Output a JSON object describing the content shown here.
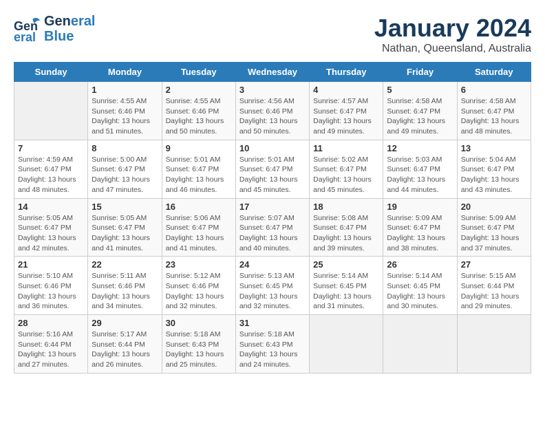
{
  "header": {
    "logo_line1": "General",
    "logo_line2": "Blue",
    "month": "January 2024",
    "location": "Nathan, Queensland, Australia"
  },
  "weekdays": [
    "Sunday",
    "Monday",
    "Tuesday",
    "Wednesday",
    "Thursday",
    "Friday",
    "Saturday"
  ],
  "weeks": [
    [
      {
        "day": "",
        "info": ""
      },
      {
        "day": "1",
        "info": "Sunrise: 4:55 AM\nSunset: 6:46 PM\nDaylight: 13 hours\nand 51 minutes."
      },
      {
        "day": "2",
        "info": "Sunrise: 4:55 AM\nSunset: 6:46 PM\nDaylight: 13 hours\nand 50 minutes."
      },
      {
        "day": "3",
        "info": "Sunrise: 4:56 AM\nSunset: 6:46 PM\nDaylight: 13 hours\nand 50 minutes."
      },
      {
        "day": "4",
        "info": "Sunrise: 4:57 AM\nSunset: 6:47 PM\nDaylight: 13 hours\nand 49 minutes."
      },
      {
        "day": "5",
        "info": "Sunrise: 4:58 AM\nSunset: 6:47 PM\nDaylight: 13 hours\nand 49 minutes."
      },
      {
        "day": "6",
        "info": "Sunrise: 4:58 AM\nSunset: 6:47 PM\nDaylight: 13 hours\nand 48 minutes."
      }
    ],
    [
      {
        "day": "7",
        "info": "Sunrise: 4:59 AM\nSunset: 6:47 PM\nDaylight: 13 hours\nand 48 minutes."
      },
      {
        "day": "8",
        "info": "Sunrise: 5:00 AM\nSunset: 6:47 PM\nDaylight: 13 hours\nand 47 minutes."
      },
      {
        "day": "9",
        "info": "Sunrise: 5:01 AM\nSunset: 6:47 PM\nDaylight: 13 hours\nand 46 minutes."
      },
      {
        "day": "10",
        "info": "Sunrise: 5:01 AM\nSunset: 6:47 PM\nDaylight: 13 hours\nand 45 minutes."
      },
      {
        "day": "11",
        "info": "Sunrise: 5:02 AM\nSunset: 6:47 PM\nDaylight: 13 hours\nand 45 minutes."
      },
      {
        "day": "12",
        "info": "Sunrise: 5:03 AM\nSunset: 6:47 PM\nDaylight: 13 hours\nand 44 minutes."
      },
      {
        "day": "13",
        "info": "Sunrise: 5:04 AM\nSunset: 6:47 PM\nDaylight: 13 hours\nand 43 minutes."
      }
    ],
    [
      {
        "day": "14",
        "info": "Sunrise: 5:05 AM\nSunset: 6:47 PM\nDaylight: 13 hours\nand 42 minutes."
      },
      {
        "day": "15",
        "info": "Sunrise: 5:05 AM\nSunset: 6:47 PM\nDaylight: 13 hours\nand 41 minutes."
      },
      {
        "day": "16",
        "info": "Sunrise: 5:06 AM\nSunset: 6:47 PM\nDaylight: 13 hours\nand 41 minutes."
      },
      {
        "day": "17",
        "info": "Sunrise: 5:07 AM\nSunset: 6:47 PM\nDaylight: 13 hours\nand 40 minutes."
      },
      {
        "day": "18",
        "info": "Sunrise: 5:08 AM\nSunset: 6:47 PM\nDaylight: 13 hours\nand 39 minutes."
      },
      {
        "day": "19",
        "info": "Sunrise: 5:09 AM\nSunset: 6:47 PM\nDaylight: 13 hours\nand 38 minutes."
      },
      {
        "day": "20",
        "info": "Sunrise: 5:09 AM\nSunset: 6:47 PM\nDaylight: 13 hours\nand 37 minutes."
      }
    ],
    [
      {
        "day": "21",
        "info": "Sunrise: 5:10 AM\nSunset: 6:46 PM\nDaylight: 13 hours\nand 36 minutes."
      },
      {
        "day": "22",
        "info": "Sunrise: 5:11 AM\nSunset: 6:46 PM\nDaylight: 13 hours\nand 34 minutes."
      },
      {
        "day": "23",
        "info": "Sunrise: 5:12 AM\nSunset: 6:46 PM\nDaylight: 13 hours\nand 32 minutes."
      },
      {
        "day": "24",
        "info": "Sunrise: 5:13 AM\nSunset: 6:45 PM\nDaylight: 13 hours\nand 32 minutes."
      },
      {
        "day": "25",
        "info": "Sunrise: 5:14 AM\nSunset: 6:45 PM\nDaylight: 13 hours\nand 31 minutes."
      },
      {
        "day": "26",
        "info": "Sunrise: 5:14 AM\nSunset: 6:45 PM\nDaylight: 13 hours\nand 30 minutes."
      },
      {
        "day": "27",
        "info": "Sunrise: 5:15 AM\nSunset: 6:44 PM\nDaylight: 13 hours\nand 29 minutes."
      }
    ],
    [
      {
        "day": "28",
        "info": "Sunrise: 5:16 AM\nSunset: 6:44 PM\nDaylight: 13 hours\nand 27 minutes."
      },
      {
        "day": "29",
        "info": "Sunrise: 5:17 AM\nSunset: 6:44 PM\nDaylight: 13 hours\nand 26 minutes."
      },
      {
        "day": "30",
        "info": "Sunrise: 5:18 AM\nSunset: 6:43 PM\nDaylight: 13 hours\nand 25 minutes."
      },
      {
        "day": "31",
        "info": "Sunrise: 5:18 AM\nSunset: 6:43 PM\nDaylight: 13 hours\nand 24 minutes."
      },
      {
        "day": "",
        "info": ""
      },
      {
        "day": "",
        "info": ""
      },
      {
        "day": "",
        "info": ""
      }
    ]
  ]
}
